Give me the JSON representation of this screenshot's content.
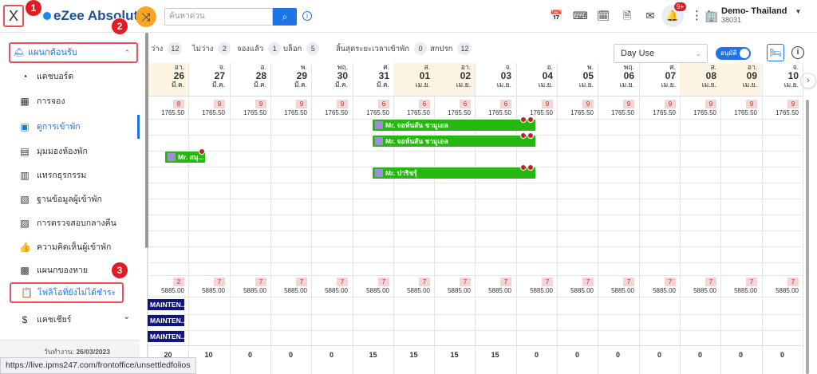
{
  "header": {
    "close_symbol": "X",
    "brand": "eZee Absolute",
    "search_placeholder": "ค้นหาด่วน",
    "notif_badge": "9+",
    "hotel_name": "Demo- Thailand",
    "hotel_id": "38031",
    "icons": [
      "calendar-add-icon",
      "keyboard-icon",
      "calendar-icon",
      "document-icon",
      "mail-icon",
      "bell-icon",
      "grid-icon"
    ]
  },
  "annotations": {
    "n1": "1",
    "n2": "2",
    "n3": "3"
  },
  "sidebar": {
    "section_title": "แผนกต้อนรับ",
    "items": [
      {
        "label": "แดชบอร์ด",
        "icon": "dashboard-icon"
      },
      {
        "label": "การจอง",
        "icon": "calendar-icon"
      },
      {
        "label": "ดูการเข้าพัก",
        "icon": "calendar-check-icon"
      },
      {
        "label": "มุมมองห้องพัก",
        "icon": "building-icon"
      },
      {
        "label": "แทรกธุรกรรม",
        "icon": "document-icon"
      },
      {
        "label": "ฐานข้อมูลผู้เข้าพัก",
        "icon": "id-card-icon"
      },
      {
        "label": "การตรวจสอบกลางคืน",
        "icon": "audit-icon"
      },
      {
        "label": "ความคิดเห็นผู้เข้าพัก",
        "icon": "thumbs-up-icon"
      },
      {
        "label": "แผนกของหาย",
        "icon": "lost-found-icon"
      },
      {
        "label": "โฟลิโอที่ยังไม่ได้ชำระ",
        "icon": "clipboard-icon"
      },
      {
        "label": "แคชเชียร์",
        "icon": "dollar-icon"
      }
    ],
    "workday_label": "วันทำงาน:",
    "workday_value": "26/03/2023"
  },
  "status_url": "https://live.ipms247.com/frontoffice/unsettledfolios",
  "stats": [
    {
      "label": "ว่าง",
      "value": "12"
    },
    {
      "label": "ไม่ว่าง",
      "value": "2"
    },
    {
      "label": "จองแล้ว",
      "value": "1"
    },
    {
      "label": "บล็อก",
      "value": "5"
    },
    {
      "label": "สิ้นสุดระยะเวลาเข้าพัก",
      "value": "0"
    },
    {
      "label": "สกปรก",
      "value": "12"
    }
  ],
  "controls": {
    "view_select": "Day Use",
    "toggle_label": "อนุมัติ"
  },
  "colors": {
    "accent": "#1e73e8",
    "reservation": "#26b810",
    "maintenance": "#11167a",
    "highlight": "#e8505b"
  },
  "dates": [
    {
      "dow": "อา.",
      "day": "26",
      "mon": "มี.ค.",
      "weekend": true
    },
    {
      "dow": "จ.",
      "day": "27",
      "mon": "มี.ค.",
      "weekend": false
    },
    {
      "dow": "อ.",
      "day": "28",
      "mon": "มี.ค.",
      "weekend": false
    },
    {
      "dow": "พ.",
      "day": "29",
      "mon": "มี.ค.",
      "weekend": false
    },
    {
      "dow": "พฤ.",
      "day": "30",
      "mon": "มี.ค.",
      "weekend": false
    },
    {
      "dow": "ศ.",
      "day": "31",
      "mon": "มี.ค.",
      "weekend": false
    },
    {
      "dow": "ส.",
      "day": "01",
      "mon": "เม.ย.",
      "weekend": true
    },
    {
      "dow": "อา.",
      "day": "02",
      "mon": "เม.ย.",
      "weekend": true
    },
    {
      "dow": "จ.",
      "day": "03",
      "mon": "เม.ย.",
      "weekend": false
    },
    {
      "dow": "อ.",
      "day": "04",
      "mon": "เม.ย.",
      "weekend": false
    },
    {
      "dow": "พ.",
      "day": "05",
      "mon": "เม.ย.",
      "weekend": false
    },
    {
      "dow": "พฤ.",
      "day": "06",
      "mon": "เม.ย.",
      "weekend": false
    },
    {
      "dow": "ศ.",
      "day": "07",
      "mon": "เม.ย.",
      "weekend": false
    },
    {
      "dow": "ส.",
      "day": "08",
      "mon": "เม.ย.",
      "weekend": true
    },
    {
      "dow": "อา.",
      "day": "09",
      "mon": "เม.ย.",
      "weekend": true
    },
    {
      "dow": "จ.",
      "day": "10",
      "mon": "เม.ย.",
      "weekend": false
    }
  ],
  "room_type_1": {
    "counts": [
      "8",
      "9",
      "9",
      "9",
      "9",
      "6",
      "6",
      "6",
      "6",
      "9",
      "9",
      "9",
      "9",
      "9",
      "9",
      "9"
    ],
    "prices": [
      "1765.50",
      "1765.50",
      "1765.50",
      "1765.50",
      "1765.50",
      "1765.50",
      "1765.50",
      "1765.50",
      "1765.50",
      "1765.50",
      "1765.50",
      "1765.50",
      "1765.50",
      "1765.50",
      "1765.50",
      "1765.50"
    ]
  },
  "reservations": [
    {
      "name": "Mr. จอห์นสัน ชามูเอล"
    },
    {
      "name": "Mr. จอห์นสัน ชามูเอล"
    },
    {
      "name": "Mr. สมุ..."
    },
    {
      "name": "Mr. ปาริชรุ์"
    }
  ],
  "room_type_2": {
    "counts": [
      "2",
      "7",
      "7",
      "7",
      "7",
      "7",
      "7",
      "7",
      "7",
      "7",
      "7",
      "7",
      "7",
      "7",
      "7",
      "7"
    ],
    "prices": [
      "5885.00",
      "5885.00",
      "5885.00",
      "5885.00",
      "5885.00",
      "5885.00",
      "5885.00",
      "5885.00",
      "5885.00",
      "5885.00",
      "5885.00",
      "5885.00",
      "5885.00",
      "5885.00",
      "5885.00",
      "5885.00"
    ]
  },
  "maintenance": [
    "MAINTEN...",
    "MAINTEN...",
    "MAINTEN..."
  ],
  "totals": [
    "20",
    "10",
    "0",
    "0",
    "0",
    "15",
    "15",
    "15",
    "15",
    "0",
    "0",
    "0",
    "0",
    "0",
    "0",
    "0"
  ]
}
